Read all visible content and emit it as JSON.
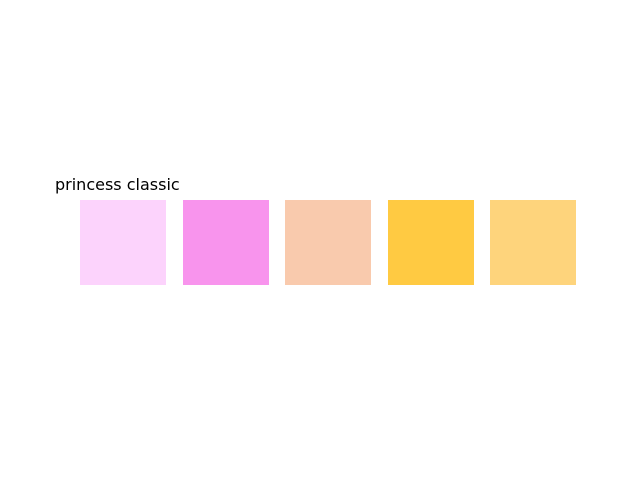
{
  "palette": {
    "title": "princess classic",
    "swatches": [
      {
        "color": "#FCD3FC"
      },
      {
        "color": "#F894ED"
      },
      {
        "color": "#F9CAAD"
      },
      {
        "color": "#FFCA42"
      },
      {
        "color": "#FED47C"
      }
    ]
  }
}
